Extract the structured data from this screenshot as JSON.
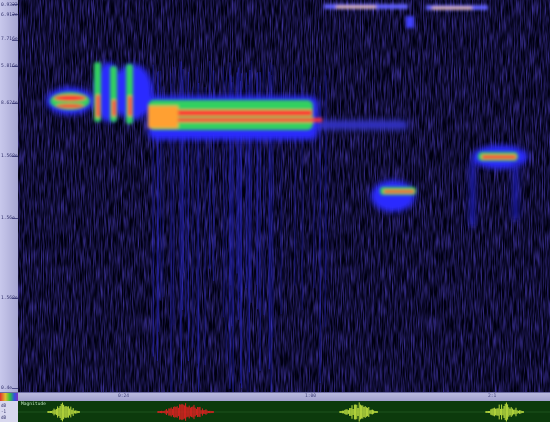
{
  "frequency_axis": {
    "labels": [
      "0.9322e",
      "6.912e",
      "7.716e",
      "5.816e",
      "8.624e",
      "1.568e",
      "1.56e",
      "1.568e",
      "0.4e"
    ]
  },
  "time_axis": {
    "labels": [
      "0:24",
      "1:00",
      "2:1"
    ]
  },
  "waveform_panel": {
    "caption": "Magnitude",
    "amplitude_labels": [
      "dB",
      "-1",
      "dB"
    ]
  },
  "colors": {
    "background": "#000000",
    "low_energy": "#2020c0",
    "mid_energy": "#20c060",
    "high_energy": "#ff2020",
    "waveform": "#c0e040",
    "waveform_selected": "#e02020",
    "waveform_bg": "#0c3a0c"
  },
  "icons": {
    "corner": "color-palette-icon"
  }
}
